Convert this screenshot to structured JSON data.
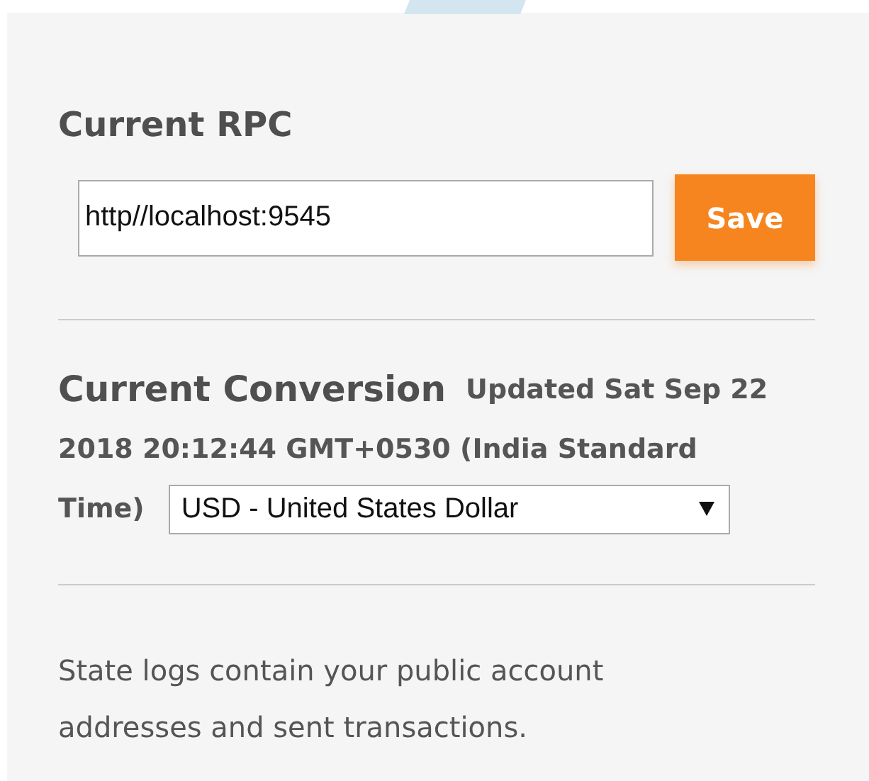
{
  "rpc": {
    "heading": "Current RPC",
    "value": "http//localhost:9545",
    "save_label": "Save"
  },
  "conversion": {
    "heading": "Current Conversion",
    "updated_lines": [
      "Updated Sat Sep 22",
      "2018 20:12:44 GMT+0530 (India Standard",
      "Time)"
    ],
    "currency": "USD - United States Dollar"
  },
  "state_logs": {
    "text": "State logs contain your public account addresses and sent transactions."
  }
}
